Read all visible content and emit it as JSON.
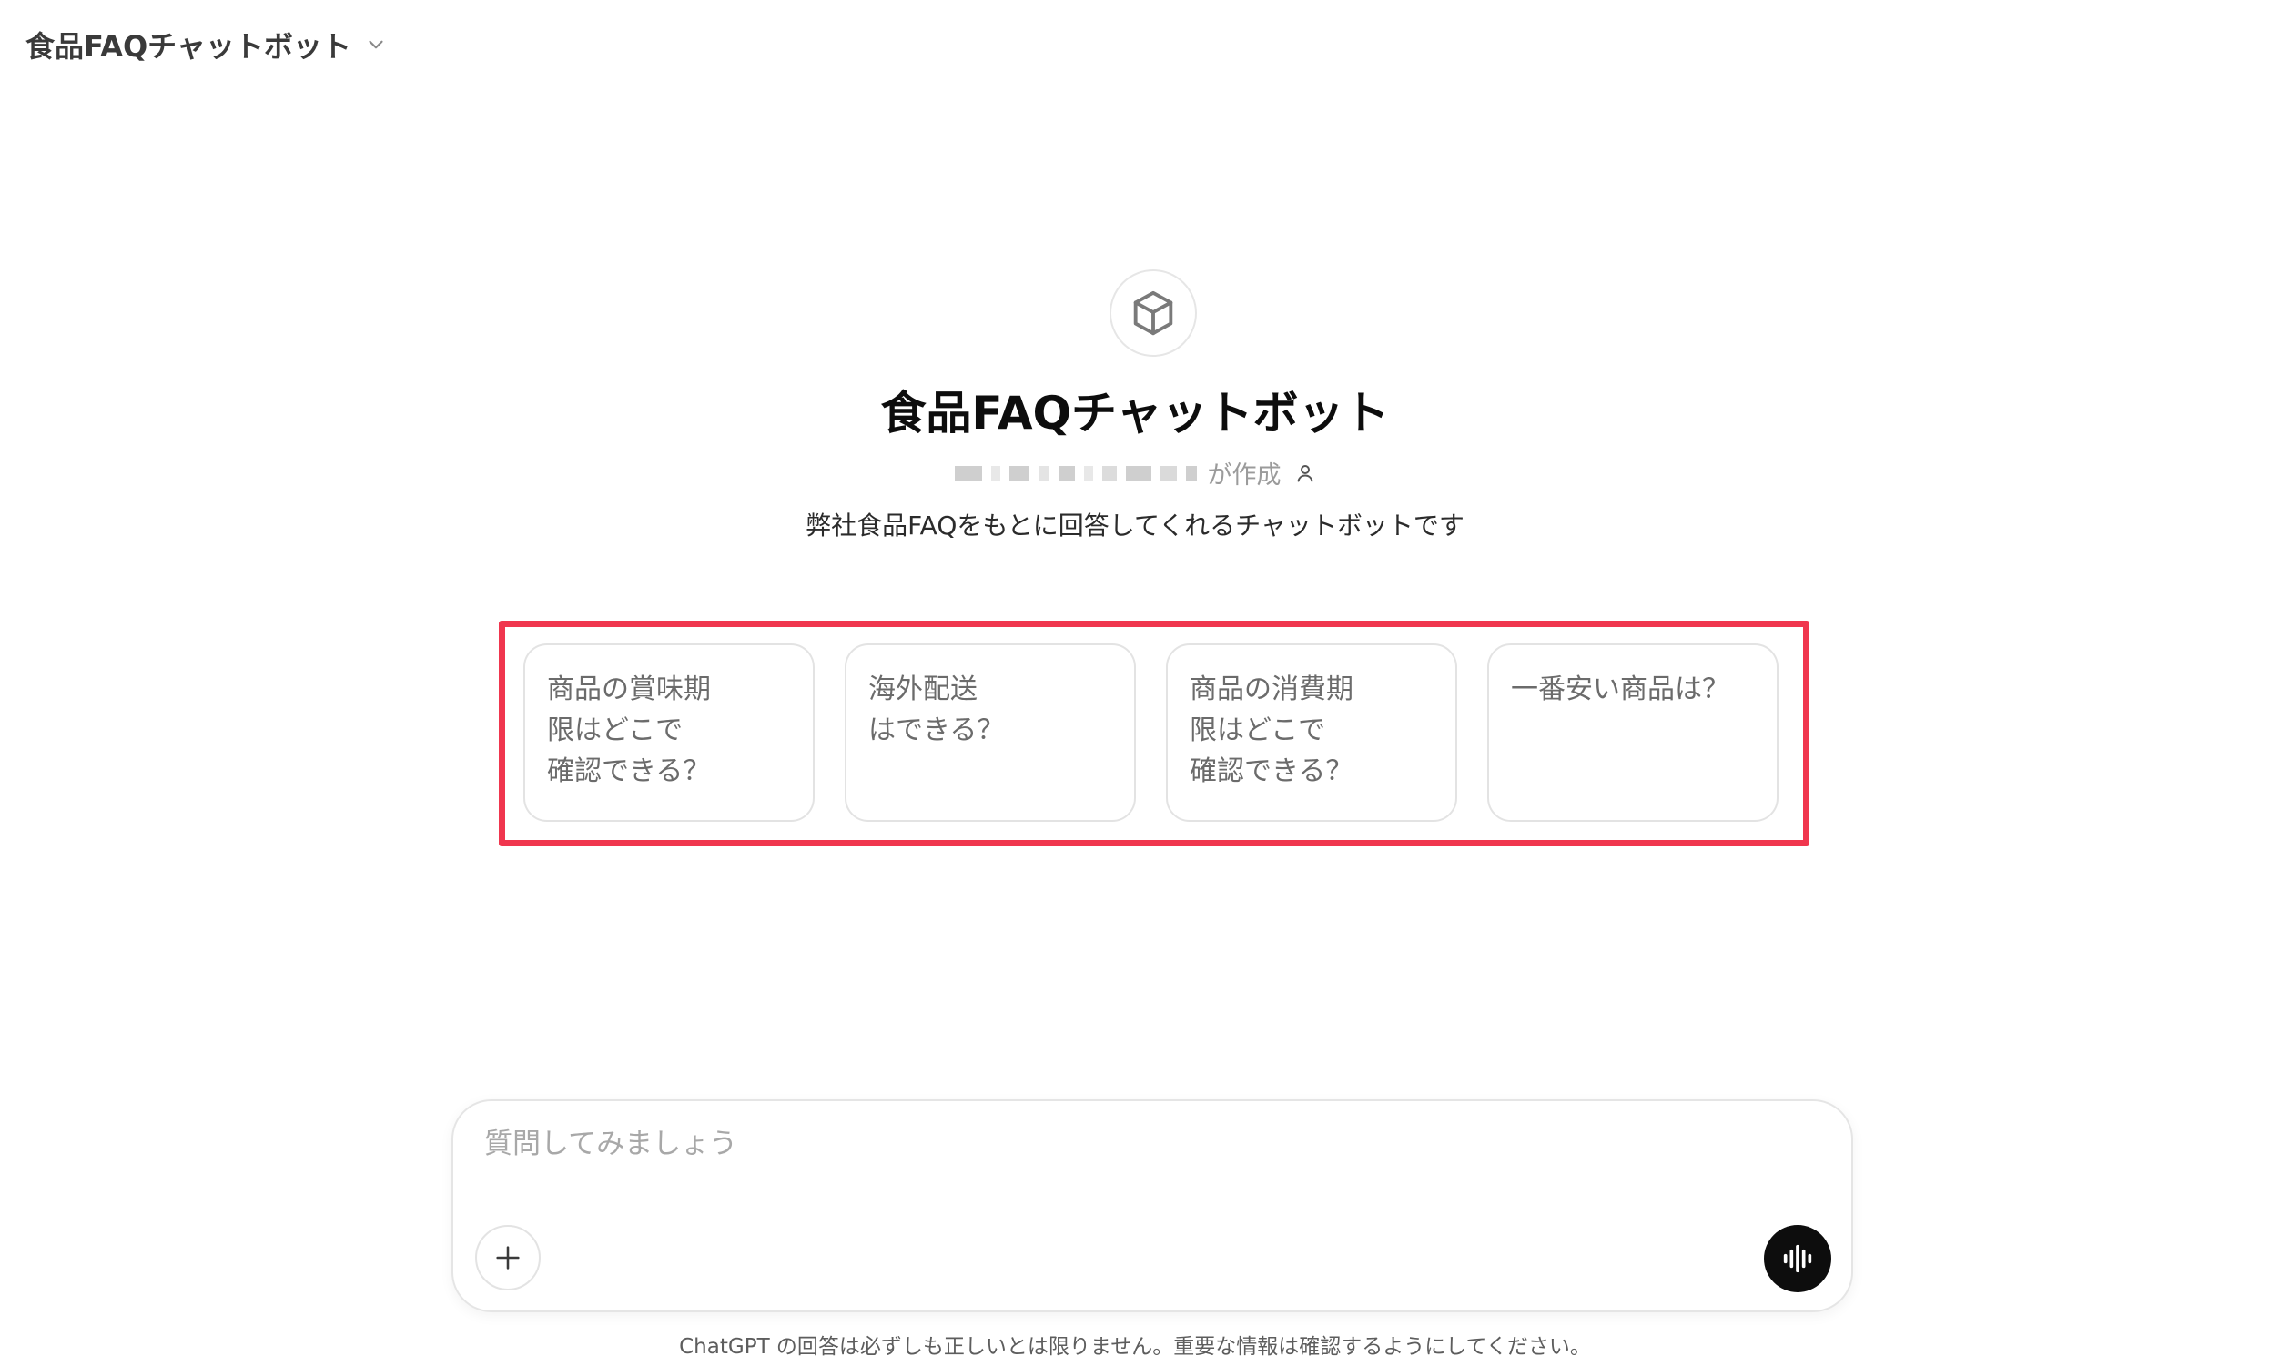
{
  "header": {
    "title": "食品FAQチャットボット",
    "dropdown_icon": "chevron-down-icon"
  },
  "gpt": {
    "avatar_icon": "cube-icon",
    "title": "食品FAQチャットボット",
    "author_suffix": "が作成",
    "author_icon": "person-icon",
    "description": "弊社食品FAQをもとに回答してくれるチャットボットです"
  },
  "starters": [
    "商品の賞味期\n限はどこで\n確認できる？",
    "海外配送\nはできる？",
    "商品の消費期\n限はどこで\n確認できる？",
    "一番安い商品は？"
  ],
  "composer": {
    "placeholder": "質問してみましょう",
    "attach_icon": "plus-icon",
    "voice_icon": "voice-waveform-icon"
  },
  "footer": {
    "disclaimer": "ChatGPT の回答は必ずしも正しいとは限りません。重要な情報は確認するようにしてください。"
  },
  "colors": {
    "highlight": "#f0364e",
    "voice_button": "#0d0d0d"
  }
}
